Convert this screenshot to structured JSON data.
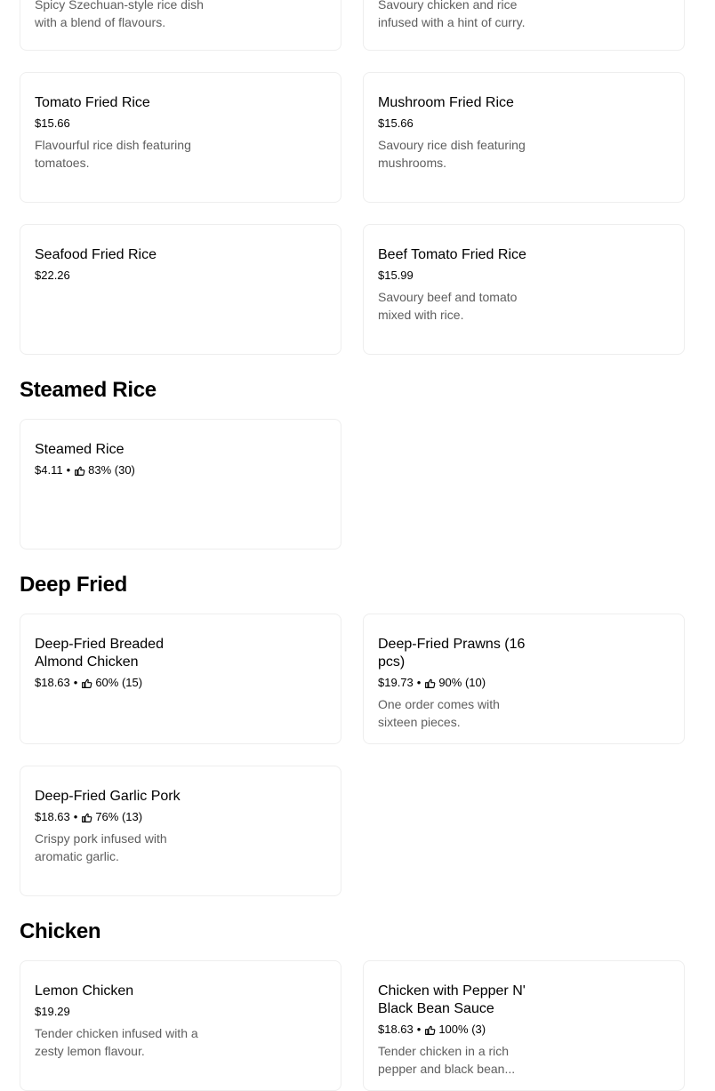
{
  "top_partial": [
    {
      "description": "Spicy Szechuan-style rice dish with a blend of flavours."
    },
    {
      "description": "Savoury chicken and rice infused with a hint of curry."
    }
  ],
  "fried_rice_items": [
    {
      "name": "Tomato Fried Rice",
      "price": "$15.66",
      "description": "Flavourful rice dish featuring tomatoes."
    },
    {
      "name": "Mushroom Fried Rice",
      "price": "$15.66",
      "description": "Savoury rice dish featuring mushrooms."
    },
    {
      "name": "Seafood Fried Rice",
      "price": "$22.26",
      "description": ""
    },
    {
      "name": "Beef Tomato Fried Rice",
      "price": "$15.99",
      "description": "Savoury beef and tomato mixed with rice."
    }
  ],
  "sections": {
    "steamed_rice": {
      "title": "Steamed Rice",
      "items": [
        {
          "name": "Steamed Rice",
          "price": "$4.11",
          "separator": "•",
          "rating": "83% (30)",
          "description": ""
        }
      ]
    },
    "deep_fried": {
      "title": "Deep Fried",
      "items": [
        {
          "name": "Deep-Fried Breaded Almond Chicken",
          "price": "$18.63",
          "separator": "•",
          "rating": "60% (15)",
          "description": ""
        },
        {
          "name": "Deep-Fried Prawns (16 pcs)",
          "price": "$19.73",
          "separator": "•",
          "rating": "90% (10)",
          "description": "One order comes with sixteen pieces."
        },
        {
          "name": "Deep-Fried Garlic Pork",
          "price": "$18.63",
          "separator": "•",
          "rating": "76% (13)",
          "description": "Crispy pork infused with aromatic garlic."
        }
      ]
    },
    "chicken": {
      "title": "Chicken",
      "items": [
        {
          "name": "Lemon Chicken",
          "price": "$19.29",
          "description": "Tender chicken infused with a zesty lemon flavour."
        },
        {
          "name": "Chicken with Pepper N' Black Bean Sauce",
          "price": "$18.63",
          "separator": "•",
          "rating": "100% (3)",
          "description": "Tender chicken in a rich pepper and black bean..."
        }
      ]
    }
  },
  "icons": {
    "rating": "thumbs-up-icon"
  },
  "colors": {
    "text": "#000000",
    "muted": "#5e5e5e",
    "border": "#eeeeee"
  }
}
